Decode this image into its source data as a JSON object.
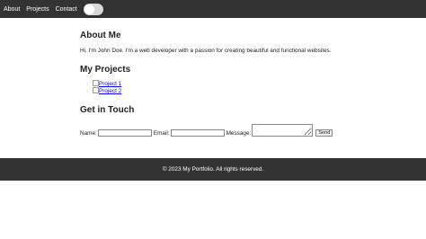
{
  "nav": {
    "items": [
      {
        "label": "About"
      },
      {
        "label": "Projects"
      },
      {
        "label": "Contact"
      }
    ],
    "theme_toggle": {
      "state": "off"
    }
  },
  "about": {
    "heading": "About Me",
    "text": "Hi, I'm John Doe. I'm a web developer with a passion for creating beautiful and functional websites."
  },
  "projects": {
    "heading": "My Projects",
    "items": [
      {
        "label": "Project 1"
      },
      {
        "label": "Project 2"
      }
    ]
  },
  "contact": {
    "heading": "Get in Touch",
    "name_label": "Name:",
    "email_label": "Email:",
    "message_label": "Message:",
    "send_label": "Send"
  },
  "footer": {
    "text": "© 2023 My Portfolio. All rights reserved."
  },
  "colors": {
    "nav_background": "#333333",
    "footer_background": "#333333",
    "link": "#0000ee"
  }
}
